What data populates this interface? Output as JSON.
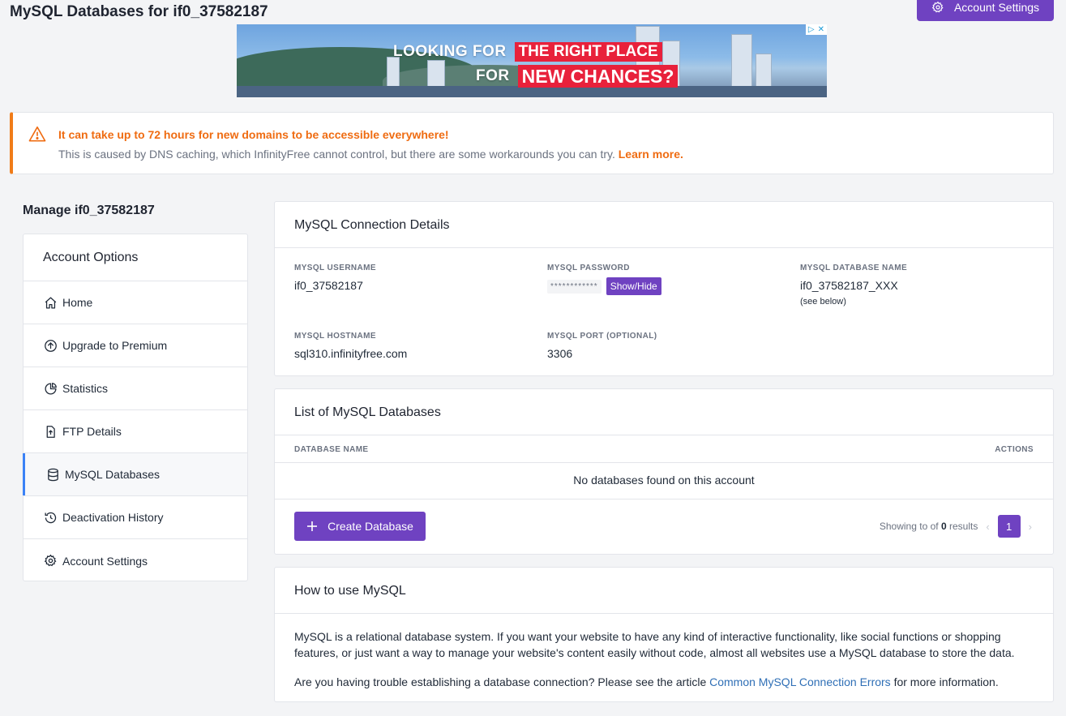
{
  "page": {
    "title": "MySQL Databases for if0_37582187",
    "account_settings_button": "Account Settings"
  },
  "ad": {
    "line1_white": "LOOKING FOR",
    "line1_red": "THE RIGHT PLACE",
    "line2_white": "FOR",
    "line2_red": "NEW CHANCES?"
  },
  "alert": {
    "title": "It can take up to 72 hours for new domains to be accessible everywhere!",
    "text": "This is caused by DNS caching, which InfinityFree cannot control, but there are some workarounds you can try.",
    "link": "Learn more."
  },
  "sidebar": {
    "manage_title": "Manage if0_37582187",
    "header": "Account Options",
    "items": [
      {
        "label": "Home",
        "icon": "home-icon"
      },
      {
        "label": "Upgrade to Premium",
        "icon": "arrow-up-circle-icon"
      },
      {
        "label": "Statistics",
        "icon": "pie-chart-icon"
      },
      {
        "label": "FTP Details",
        "icon": "file-upload-icon"
      },
      {
        "label": "MySQL Databases",
        "icon": "database-icon",
        "active": true
      },
      {
        "label": "Deactivation History",
        "icon": "history-icon"
      },
      {
        "label": "Account Settings",
        "icon": "gear-icon"
      }
    ]
  },
  "connection": {
    "title": "MySQL Connection Details",
    "username_label": "MYSQL USERNAME",
    "username": "if0_37582187",
    "password_label": "MYSQL PASSWORD",
    "password_mask": "************",
    "show_hide": "Show/Hide",
    "dbname_label": "MYSQL DATABASE NAME",
    "dbname": "if0_37582187_XXX",
    "dbname_note": "(see below)",
    "hostname_label": "MYSQL HOSTNAME",
    "hostname": "sql310.infinityfree.com",
    "port_label": "MYSQL PORT (OPTIONAL)",
    "port": "3306"
  },
  "databases": {
    "title": "List of MySQL Databases",
    "col_name": "DATABASE NAME",
    "col_actions": "ACTIONS",
    "empty": "No databases found on this account",
    "create_button": "Create Database",
    "showing_prefix": "Showing to of",
    "showing_count": "0",
    "showing_suffix": "results",
    "prev": "‹",
    "page": "1",
    "next": "›"
  },
  "howto": {
    "title": "How to use MySQL",
    "para1": "MySQL is a relational database system. If you want your website to have any kind of interactive functionality, like social functions or shopping features, or just want a way to manage your website's content easily without code, almost all websites use a MySQL database to store the data.",
    "para2_prefix": "Are you having trouble establishing a database connection? Please see the article",
    "para2_link": "Common MySQL Connection Errors",
    "para2_suffix": "for more information."
  },
  "colors": {
    "accent": "#6f42c1",
    "warning": "#ef6c12",
    "link": "#2f6fb6",
    "active_bar": "#3b82f6"
  }
}
